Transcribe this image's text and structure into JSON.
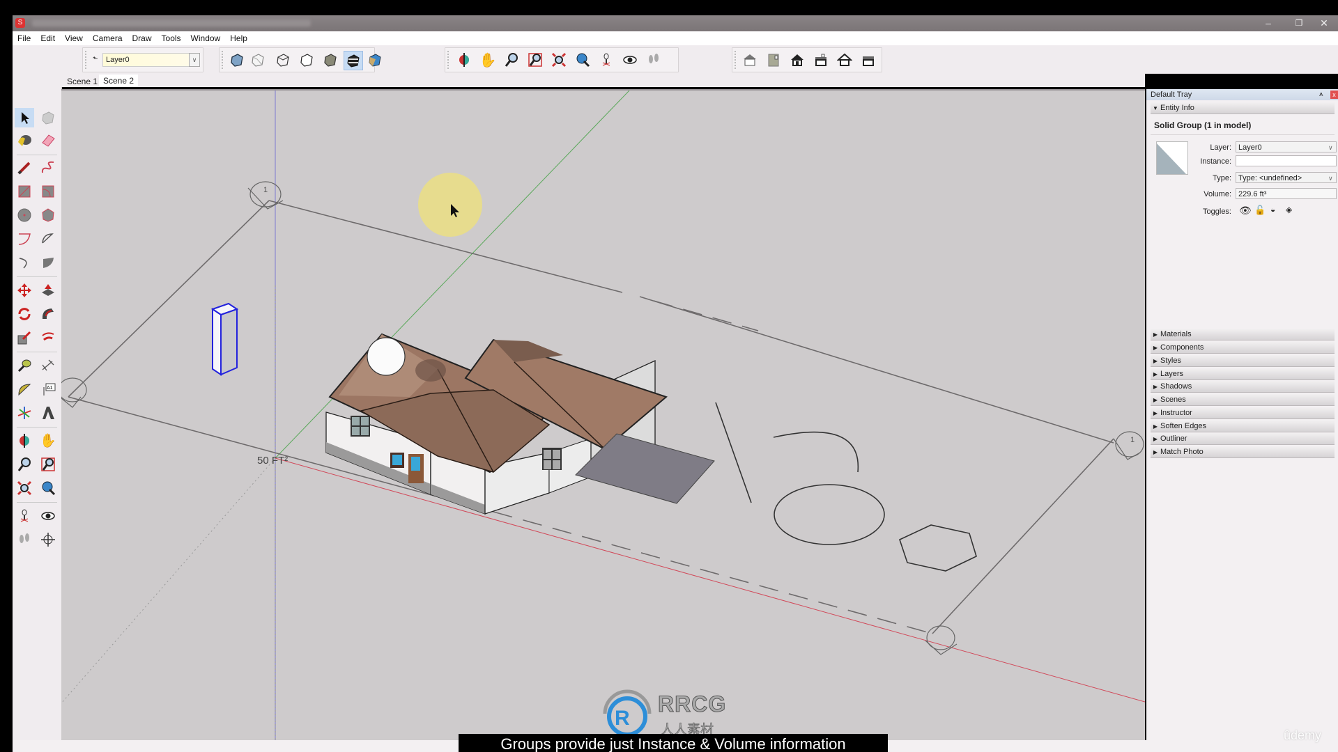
{
  "window": {
    "title": "",
    "minimize_icon": "minimize-icon",
    "restore_icon": "restore-icon",
    "close_icon": "close-icon"
  },
  "menu": [
    "File",
    "Edit",
    "View",
    "Camera",
    "Draw",
    "Tools",
    "Window",
    "Help"
  ],
  "layers_toolbar": {
    "current_layer": "Layer0"
  },
  "scene_tabs": [
    {
      "label": "Scene 1",
      "active": false
    },
    {
      "label": "Scene 2",
      "active": true
    }
  ],
  "style_toolbar": [
    "xray",
    "back-edges",
    "wireframe",
    "hidden-line",
    "shaded",
    "shaded-with-textures",
    "monochrome"
  ],
  "camera_toolbar": [
    "orbit",
    "pan",
    "zoom",
    "zoom-window",
    "zoom-extents",
    "previous-view",
    "position-camera",
    "look-around",
    "walk"
  ],
  "views_toolbar": [
    "iso",
    "top",
    "front",
    "right",
    "back",
    "left"
  ],
  "viewport": {
    "dimension_label": "50 FT²",
    "section_marker_label": "1"
  },
  "tray": {
    "title": "Default Tray",
    "entity_info": {
      "panel_title": "Entity Info",
      "heading": "Solid Group (1 in model)",
      "layer_label": "Layer:",
      "layer_value": "Layer0",
      "instance_label": "Instance:",
      "instance_value": "",
      "type_label": "Type:",
      "type_value": "Type: <undefined>",
      "volume_label": "Volume:",
      "volume_value": "229.6 ft³",
      "toggles_label": "Toggles:"
    },
    "panels": [
      "Materials",
      "Components",
      "Styles",
      "Layers",
      "Shadows",
      "Scenes",
      "Instructor",
      "Soften Edges",
      "Outliner",
      "Match Photo"
    ]
  },
  "overlay": {
    "subtitle": "Groups provide just Instance & Volume information",
    "watermark_main": "RRCG",
    "watermark_sub": "人人素材",
    "udemy": "ûdemy"
  }
}
